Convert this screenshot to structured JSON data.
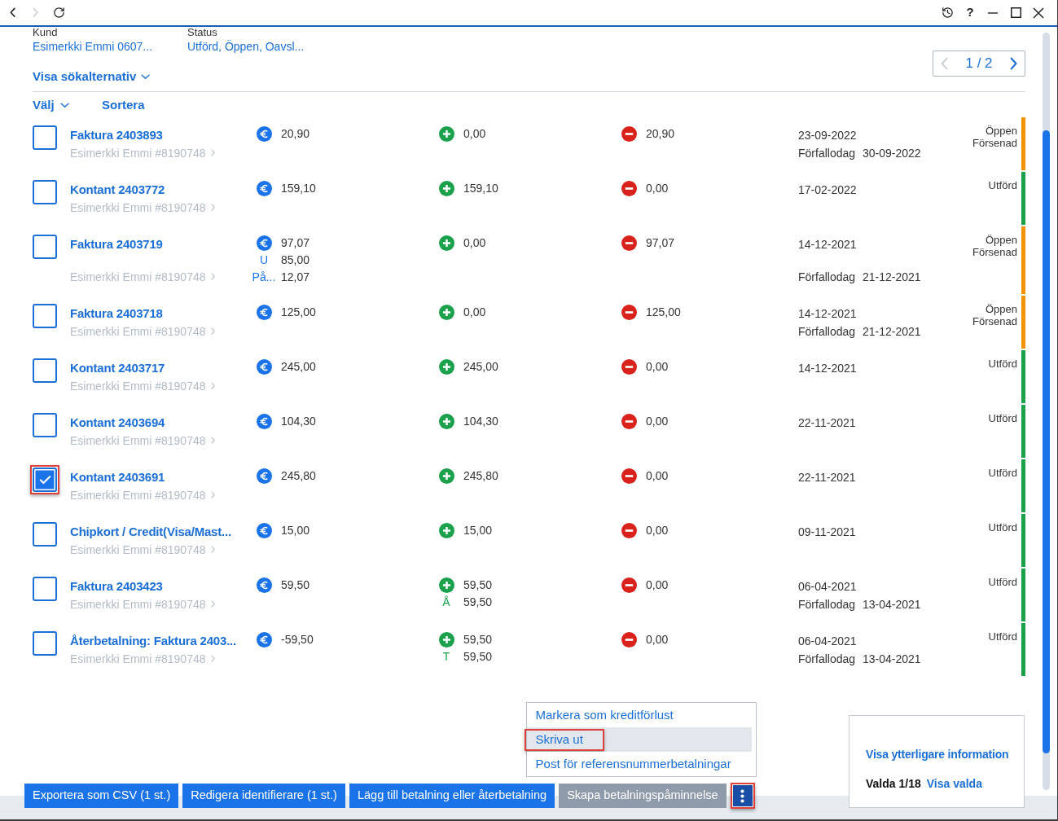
{
  "titlebar": {
    "nav": [
      {
        "kind": "back",
        "disabled": false
      },
      {
        "kind": "forward",
        "disabled": true
      },
      {
        "kind": "reload",
        "disabled": false
      }
    ],
    "help": "?"
  },
  "filters": [
    {
      "label": "Kund",
      "value": "Esimerkki Emmi 0607..."
    },
    {
      "label": "Status",
      "value": "Utförd, Öppen, Oavsl..."
    }
  ],
  "pager": {
    "text": "1 / 2",
    "prev_disabled": true,
    "next_disabled": false
  },
  "search_options": {
    "label": "Visa sökalternativ",
    "expanded": false
  },
  "list_header": {
    "select": {
      "label": "Välj",
      "expanded": false
    },
    "sort": "Sortera"
  },
  "rows": [
    {
      "title": "Faktura 2403893",
      "customer": "Esimerkki Emmi #8190748",
      "checked": false,
      "highlighted": false,
      "amounts": [
        {
          "kind": "total",
          "value": "20,90"
        },
        {
          "kind": "paid",
          "value": "0,00"
        },
        {
          "kind": "balance",
          "value": "20,90"
        }
      ],
      "date": "23-09-2022",
      "due": {
        "label": "Förfallodag",
        "value": "30-09-2022"
      },
      "statuses": [
        "Öppen",
        "Försenad"
      ],
      "color": "#f39200"
    },
    {
      "title": "Kontant 2403772",
      "customer": "Esimerkki Emmi #8190748",
      "checked": false,
      "highlighted": false,
      "amounts": [
        {
          "kind": "total",
          "value": "159,10"
        },
        {
          "kind": "paid",
          "value": "159,10"
        },
        {
          "kind": "balance",
          "value": "0,00"
        }
      ],
      "date": "17-02-2022",
      "statuses": [
        "Utförd"
      ],
      "color": "#1ba14b"
    },
    {
      "title": "Faktura 2403719",
      "customer": "Esimerkki Emmi #8190748",
      "checked": false,
      "highlighted": false,
      "amounts": [
        {
          "kind": "total",
          "value": "97,07",
          "details": [
            {
              "label": "U",
              "value": "85,00"
            },
            {
              "label": "På...",
              "value": "12,07"
            }
          ]
        },
        {
          "kind": "paid",
          "value": "0,00"
        },
        {
          "kind": "balance",
          "value": "97,07"
        }
      ],
      "date": "14-12-2021",
      "due": {
        "label": "Förfallodag",
        "value": "21-12-2021"
      },
      "statuses": [
        "Öppen",
        "Försenad"
      ],
      "color": "#f39200"
    },
    {
      "title": "Faktura 2403718",
      "customer": "Esimerkki Emmi #8190748",
      "checked": false,
      "highlighted": false,
      "amounts": [
        {
          "kind": "total",
          "value": "125,00"
        },
        {
          "kind": "paid",
          "value": "0,00"
        },
        {
          "kind": "balance",
          "value": "125,00"
        }
      ],
      "date": "14-12-2021",
      "due": {
        "label": "Förfallodag",
        "value": "21-12-2021"
      },
      "statuses": [
        "Öppen",
        "Försenad"
      ],
      "color": "#f39200"
    },
    {
      "title": "Kontant 2403717",
      "customer": "Esimerkki Emmi #8190748",
      "checked": false,
      "highlighted": false,
      "amounts": [
        {
          "kind": "total",
          "value": "245,00"
        },
        {
          "kind": "paid",
          "value": "245,00"
        },
        {
          "kind": "balance",
          "value": "0,00"
        }
      ],
      "date": "14-12-2021",
      "statuses": [
        "Utförd"
      ],
      "color": "#1ba14b"
    },
    {
      "title": "Kontant 2403694",
      "customer": "Esimerkki Emmi #8190748",
      "checked": false,
      "highlighted": false,
      "amounts": [
        {
          "kind": "total",
          "value": "104,30"
        },
        {
          "kind": "paid",
          "value": "104,30"
        },
        {
          "kind": "balance",
          "value": "0,00"
        }
      ],
      "date": "22-11-2021",
      "statuses": [
        "Utförd"
      ],
      "color": "#1ba14b"
    },
    {
      "title": "Kontant 2403691",
      "customer": "Esimerkki Emmi #8190748",
      "checked": true,
      "highlighted": true,
      "amounts": [
        {
          "kind": "total",
          "value": "245,80"
        },
        {
          "kind": "paid",
          "value": "245,80"
        },
        {
          "kind": "balance",
          "value": "0,00"
        }
      ],
      "date": "22-11-2021",
      "statuses": [
        "Utförd"
      ],
      "color": "#1ba14b"
    },
    {
      "title": "Chipkort / Credit(Visa/Mast...",
      "customer": "Esimerkki Emmi #8190748",
      "checked": false,
      "highlighted": false,
      "amounts": [
        {
          "kind": "total",
          "value": "15,00"
        },
        {
          "kind": "paid",
          "value": "15,00"
        },
        {
          "kind": "balance",
          "value": "0,00"
        }
      ],
      "date": "09-11-2021",
      "statuses": [
        "Utförd"
      ],
      "color": "#1ba14b"
    },
    {
      "title": "Faktura 2403423",
      "customer": "Esimerkki Emmi #8190748",
      "checked": false,
      "highlighted": false,
      "amounts": [
        {
          "kind": "total",
          "value": "59,50"
        },
        {
          "kind": "paid",
          "value": "59,50",
          "details": [
            {
              "label": "Å",
              "value": "59,50"
            }
          ]
        },
        {
          "kind": "balance",
          "value": "0,00"
        }
      ],
      "date": "06-04-2021",
      "due": {
        "label": "Förfallodag",
        "value": "13-04-2021"
      },
      "statuses": [
        "Utförd"
      ],
      "color": "#1ba14b"
    },
    {
      "title": "Återbetalning: Faktura 2403...",
      "customer": "Esimerkki Emmi #8190748",
      "checked": false,
      "highlighted": false,
      "amounts": [
        {
          "kind": "total",
          "value": "-59,50"
        },
        {
          "kind": "paid",
          "value": "59,50",
          "details": [
            {
              "label": "T",
              "value": "59,50"
            }
          ]
        },
        {
          "kind": "balance",
          "value": "0,00"
        }
      ],
      "date": "06-04-2021",
      "due": {
        "label": "Förfallodag",
        "value": "13-04-2021"
      },
      "statuses": [
        "Utförd"
      ],
      "color": "#1ba14b"
    }
  ],
  "actions": [
    {
      "label": "Exportera som CSV (1 st.)",
      "disabled": false
    },
    {
      "label": "Redigera identifierare (1 st.)",
      "disabled": false
    },
    {
      "label": "Lägg till betalning eller återbetalning",
      "disabled": false
    },
    {
      "label": "Skapa betalningspåminnelse",
      "disabled": true
    }
  ],
  "more_button": {
    "highlighted": true,
    "expanded": true,
    "menu": [
      {
        "label": "Markera som kreditförlust",
        "selected": false,
        "highlighted": false
      },
      {
        "label": "Skriva ut",
        "selected": true,
        "highlighted": true
      },
      {
        "label": "Post för referensnummerbetalningar",
        "selected": false,
        "highlighted": false
      }
    ]
  },
  "info_card": {
    "link": "Visa ytterligare information",
    "selected_count": "Valda 1/18",
    "show_selected": "Visa valda"
  }
}
